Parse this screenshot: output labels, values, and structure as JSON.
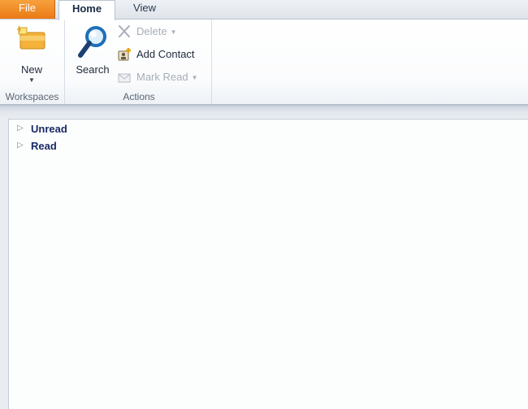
{
  "tabs": [
    {
      "label": "File",
      "selected": false
    },
    {
      "label": "Home",
      "selected": true
    },
    {
      "label": "View",
      "selected": false
    }
  ],
  "ribbon": {
    "workspaces": {
      "group_label": "Workspaces",
      "new_button": {
        "label": "New",
        "icon": "new-workspace-icon"
      }
    },
    "actions": {
      "group_label": "Actions",
      "search_button": {
        "label": "Search",
        "icon": "search-icon"
      },
      "delete_button": {
        "label": "Delete",
        "icon": "delete-x-icon",
        "enabled": false
      },
      "add_contact_button": {
        "label": "Add Contact",
        "icon": "add-contact-icon",
        "enabled": true
      },
      "mark_read_button": {
        "label": "Mark Read",
        "icon": "mark-read-icon",
        "enabled": false
      }
    }
  },
  "tree": {
    "items": [
      {
        "label": "Unread",
        "expanded": false
      },
      {
        "label": "Read",
        "expanded": false
      }
    ]
  },
  "colors": {
    "file_tab": "#ea7a15",
    "tree_label": "#1a2a66",
    "disabled_text": "#a6adb6"
  }
}
